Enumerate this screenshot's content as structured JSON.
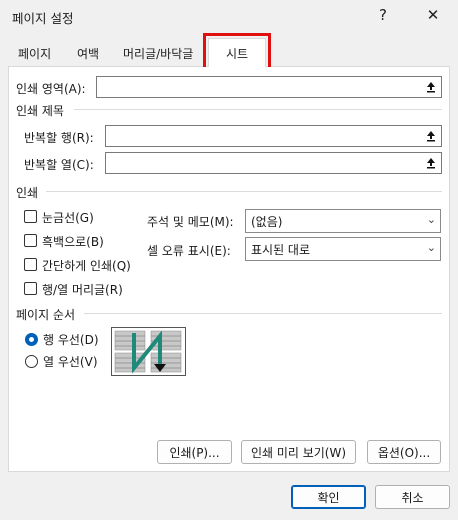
{
  "window": {
    "title": "페이지 설정",
    "help": "?",
    "close": "✕"
  },
  "tabs": [
    {
      "label": "페이지"
    },
    {
      "label": "여백"
    },
    {
      "label": "머리글/바닥글"
    },
    {
      "label": "시트"
    }
  ],
  "print_area": {
    "label": "인쇄 영역(A):",
    "value": ""
  },
  "print_titles": {
    "section": "인쇄 제목",
    "rows_label": "반복할 행(R):",
    "cols_label": "반복할 열(C):",
    "rows_value": "",
    "cols_value": ""
  },
  "print": {
    "section": "인쇄",
    "gridlines": {
      "label": "눈금선(G)",
      "checked": false
    },
    "black_white": {
      "label": "흑백으로(B)",
      "checked": false
    },
    "draft": {
      "label": "간단하게 인쇄(Q)",
      "checked": false
    },
    "headings": {
      "label": "행/열 머리글(R)",
      "checked": false
    },
    "comments_label": "주석 및 메모(M):",
    "comments_value": "(없음)",
    "errors_label": "셀 오류 표시(E):",
    "errors_value": "표시된 대로"
  },
  "page_order": {
    "section": "페이지 순서",
    "down_then_over": {
      "label": "행 우선(D)",
      "selected": true
    },
    "over_then_down": {
      "label": "열 우선(V)",
      "selected": false
    }
  },
  "buttons": {
    "print": "인쇄(P)...",
    "preview": "인쇄 미리 보기(W)",
    "options": "옵션(O)...",
    "ok": "확인",
    "cancel": "취소"
  },
  "colors": {
    "accent": "#005fb8",
    "highlight": "#e01010",
    "arrow": "#1f8a7a"
  }
}
